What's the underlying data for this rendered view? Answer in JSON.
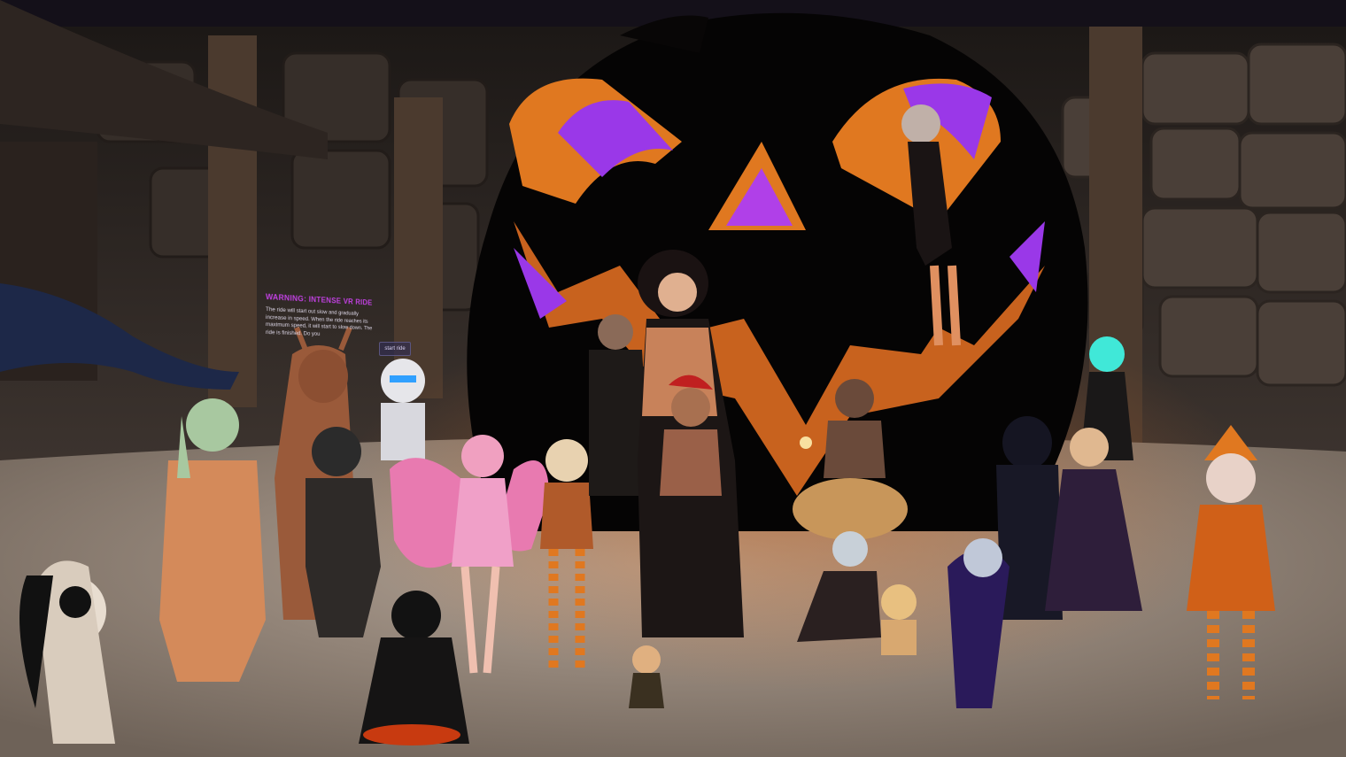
{
  "ride_sign": {
    "title": "WARNING: INTENSE VR RIDE",
    "body": "The ride will start out slow and gradually increase in speed. When the ride reaches its maximum speed, it will start to slow down. The ride is finished. Do you",
    "button_label": "start ride"
  },
  "colors": {
    "pumpkin_orange": "#e07820",
    "pumpkin_purple": "#9a38e8",
    "floor": "#a89a8e",
    "wall": "#3a302a",
    "sky": "#120e18"
  }
}
